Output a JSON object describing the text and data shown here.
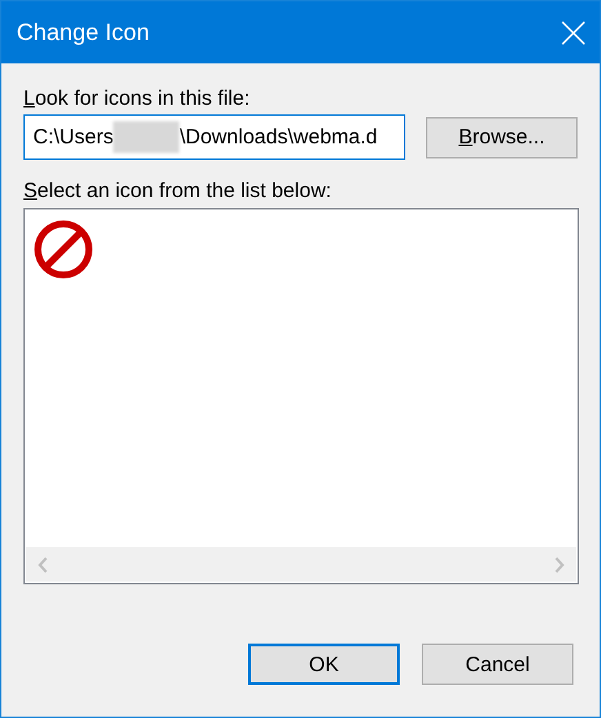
{
  "window": {
    "title": "Change Icon"
  },
  "file_label": {
    "access_key": "L",
    "rest": "ook for icons in this file:"
  },
  "file_field": {
    "value_start": "C:\\Users",
    "redacted": true,
    "value_end": "\\Downloads\\webma.d"
  },
  "browse_button": {
    "access_key": "B",
    "rest": "rowse..."
  },
  "list_label": {
    "access_key": "S",
    "rest": "elect an icon from the list below:"
  },
  "icons": [
    {
      "selected": false
    }
  ],
  "buttons": [
    {
      "label": "OK",
      "default": true
    },
    {
      "label": "Cancel",
      "default": false
    }
  ]
}
